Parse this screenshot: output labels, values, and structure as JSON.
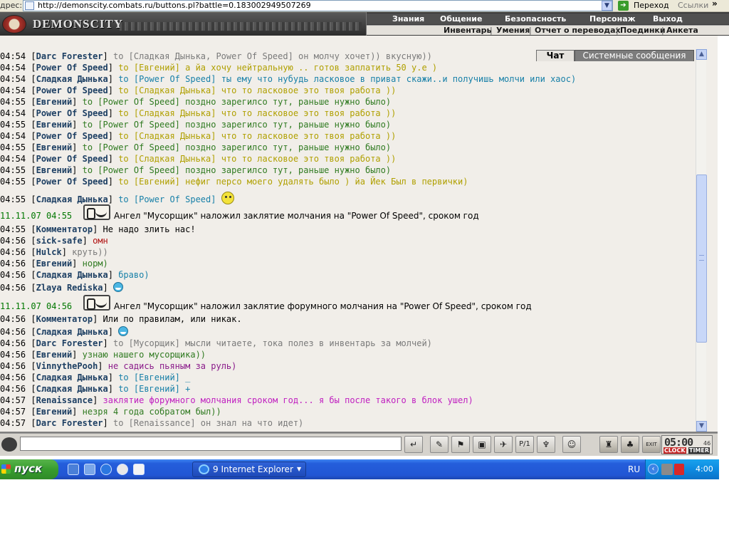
{
  "browser": {
    "address_label": "дрес:",
    "url": "http://demonscity.combats.ru/buttons.pl?battle=0.183002949507269",
    "go_label": "Переход",
    "links_label": "Ссылки",
    "links_chevron": "»"
  },
  "game": {
    "logo_text": "DEMONSCITY",
    "menu_top": [
      "Знания",
      "Общение",
      "Безопасность",
      "Персонаж",
      "Выход"
    ],
    "menu_bottom": [
      "Инвентарь",
      "Умения",
      "Отчет о переводах",
      "Поединки",
      "Анкета"
    ],
    "menu_separator": "|"
  },
  "chat": {
    "tab_chat": "Чат",
    "tab_system": "Системные сообщения",
    "lines": [
      {
        "time": "04:54",
        "nick": "Darc Forester",
        "text": "to [Сладкая Дынька, Power Of Speed] он молчу хочет)) вкусную))",
        "color": "#7a7a7a"
      },
      {
        "time": "04:54",
        "nick": "Power Of Speed",
        "text": "to [Евгений] а йа хочу нейтральную .. готов заплатить 50 у.е )",
        "color": "#b0a000"
      },
      {
        "time": "04:54",
        "nick": "Сладкая Дынька",
        "text": "to [Power Of Speed] ты ему что нубудь ласковое в приват скажи..и получишь молчи или хаос)",
        "color": "#1880a8"
      },
      {
        "time": "04:54",
        "nick": "Power Of Speed",
        "text": "to [Сладкая Дынька] что то ласковое это твоя работа ))",
        "color": "#b0a000"
      },
      {
        "time": "04:55",
        "nick": "Евгений",
        "text": "to [Power Of Speed] поздно зарегилсо тут, раньше нужно было)",
        "color": "#2f7a20"
      },
      {
        "time": "04:54",
        "nick": "Power Of Speed",
        "text": "to [Сладкая Дынька] что то ласковое это твоя работа ))",
        "color": "#b0a000"
      },
      {
        "time": "04:55",
        "nick": "Евгений",
        "text": "to [Power Of Speed] поздно зарегилсо тут, раньше нужно было)",
        "color": "#2f7a20"
      },
      {
        "time": "04:54",
        "nick": "Power Of Speed",
        "text": "to [Сладкая Дынька] что то ласковое это твоя работа ))",
        "color": "#b0a000"
      },
      {
        "time": "04:55",
        "nick": "Евгений",
        "text": "to [Power Of Speed] поздно зарегилсо тут, раньше нужно было)",
        "color": "#2f7a20"
      },
      {
        "time": "04:54",
        "nick": "Power Of Speed",
        "text": "to [Сладкая Дынька] что то ласковое это твоя работа ))",
        "color": "#b0a000"
      },
      {
        "time": "04:55",
        "nick": "Евгений",
        "text": "to [Power Of Speed] поздно зарегилсо тут, раньше нужно было)",
        "color": "#2f7a20"
      },
      {
        "time": "04:55",
        "nick": "Power Of Speed",
        "text": "to [Евгений] нефиг персо моего удалять было ) йа Йек Был в первички)",
        "color": "#b0a000"
      },
      {
        "time": "04:55",
        "nick": "Сладкая Дынька",
        "text": "to [Power Of Speed]",
        "color": "#1880a8",
        "smiley": "yellow"
      },
      {
        "system": true,
        "time": "11.11.07 04:55",
        "text": "Ангел \"Мусорщик\" наложил заклятие молчания на \"Power Of Speed\", сроком год"
      },
      {
        "time": "04:55",
        "nick": "Комментатор",
        "text": "Не надо злить нас!",
        "color": "#000000"
      },
      {
        "time": "04:56",
        "nick": "sick-safe",
        "text": "омн",
        "color": "#b01010"
      },
      {
        "time": "04:56",
        "nick": "Hulck",
        "text": "круть))",
        "color": "#7a7a7a"
      },
      {
        "time": "04:56",
        "nick": "Евгений",
        "text": "норм)",
        "color": "#2f7a20"
      },
      {
        "time": "04:56",
        "nick": "Сладкая Дынька",
        "text": "браво)",
        "color": "#1880a8"
      },
      {
        "time": "04:56",
        "nick": "Zlaya Rediska",
        "text": "",
        "color": "#000000",
        "smiley": "blue"
      },
      {
        "system": true,
        "time": "11.11.07 04:56",
        "text": "Ангел \"Мусорщик\" наложил заклятие форумного молчания на \"Power Of Speed\", сроком год"
      },
      {
        "time": "04:56",
        "nick": "Комментатор",
        "text": "Или по правилам, или никак.",
        "color": "#000000"
      },
      {
        "time": "04:56",
        "nick": "Сладкая Дынька",
        "text": "",
        "color": "#1880a8",
        "smiley": "blue"
      },
      {
        "time": "04:56",
        "nick": "Darc Forester",
        "text": "to [Мусорщик] мысли читаете, тока полез в инвентарь за молчей)",
        "color": "#7a7a7a"
      },
      {
        "time": "04:56",
        "nick": "Евгений",
        "text": "узнаю нашего мусорщика))",
        "color": "#2f7a20"
      },
      {
        "time": "04:56",
        "nick": "VinnythePooh",
        "text": "не садись пьяным за руль)",
        "color": "#8a1a8a"
      },
      {
        "time": "04:56",
        "nick": "Сладкая Дынька",
        "text": "to [Евгений] _",
        "color": "#1880a8"
      },
      {
        "time": "04:56",
        "nick": "Сладкая Дынька",
        "text": "to [Евгений] +",
        "color": "#1880a8"
      },
      {
        "time": "04:57",
        "nick": "Renaissance",
        "text": "заклятие форумного молчания сроком год... я бы после такого в блок ушел)",
        "color": "#c020c0"
      },
      {
        "time": "04:57",
        "nick": "Евгений",
        "text": "незря 4 года собратом был))",
        "color": "#2f7a20"
      },
      {
        "time": "04:57",
        "nick": "Darc Forester",
        "text": "to [Renaissance] он знал на что идет)",
        "color": "#7a7a7a"
      }
    ]
  },
  "toolbar": {
    "enter_glyph": "↵",
    "buttons": [
      "✎",
      "⚑",
      "▣",
      "✈",
      "P/1",
      "♆",
      "☺"
    ],
    "right_buttons": [
      "♜",
      "♣",
      "EXIT"
    ],
    "clock_time": "05:00",
    "clock_seconds": "46",
    "clock_label": "CLOCK",
    "timer_label": "TIMER"
  },
  "taskbar": {
    "start_label": "пуск",
    "task_label": "9 Internet Explorer",
    "lang": "RU",
    "time": "4:00"
  },
  "colors": {
    "nick": "#1d3f63",
    "system_timestamp": "#007700",
    "taskbar_blue": "#245edb",
    "start_green": "#379c2e"
  }
}
